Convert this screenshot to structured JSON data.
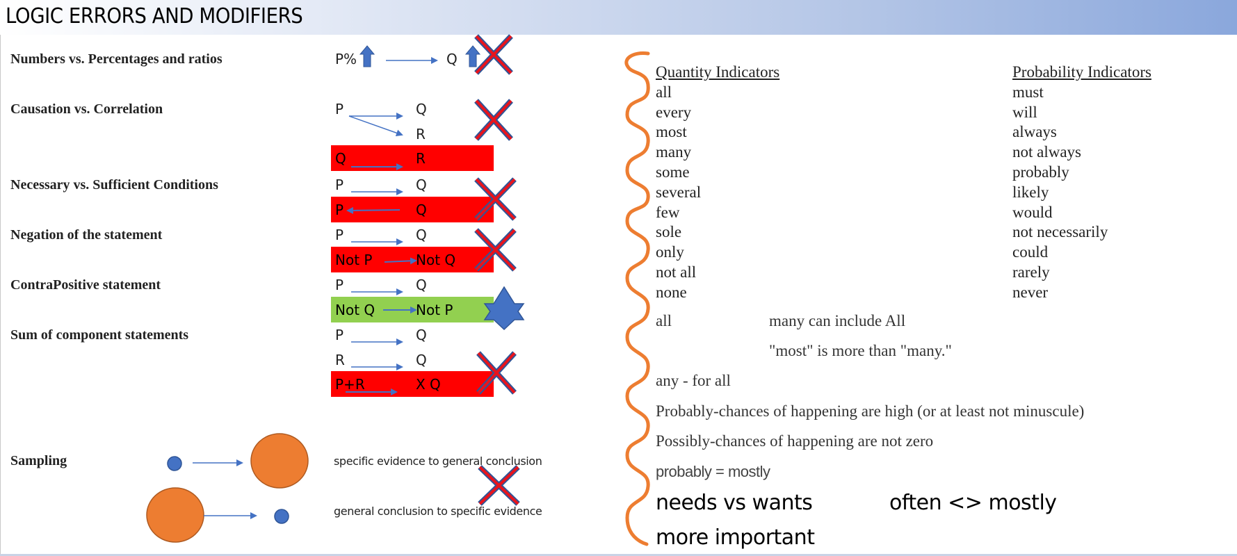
{
  "title": "LOGIC ERRORS AND MODIFIERS",
  "colors": {
    "error_bar": "#ff0000",
    "valid_bar": "#92d050",
    "arrow": "#4472c4",
    "cross": "#e8141c",
    "star": "#4472c4",
    "circle_large": "#ed7d31",
    "circle_small": "#4472c4",
    "brace": "#ed7d31"
  },
  "errors": [
    {
      "label": "Numbers vs. Percentages and ratios",
      "left": "P%",
      "right": "Q",
      "mark": "cross-icon"
    },
    {
      "label": "Causation vs. Correlation",
      "left": "P",
      "right_top": "Q",
      "right_bottom": "R",
      "bar_left": "Q",
      "bar_right": "R",
      "mark": "cross-icon"
    },
    {
      "label": "Necessary vs. Sufficient Conditions",
      "left": "P",
      "right": "Q",
      "bar_left": "P",
      "bar_right": "Q",
      "mark": "cross-icon"
    },
    {
      "label": "Negation of the statement",
      "left": "P",
      "right": "Q",
      "bar_left": "Not P",
      "bar_right": "Not Q",
      "mark": "cross-icon"
    },
    {
      "label": "ContraPositive statement",
      "left": "P",
      "right": "Q",
      "bar_left": "Not Q",
      "bar_right": "Not P",
      "mark": "star-icon"
    },
    {
      "label": "Sum of component statements",
      "row1_left": "P",
      "row1_right": "Q",
      "row2_left": "R",
      "row2_right": "Q",
      "bar_left": "P+R",
      "bar_right": "X Q",
      "mark": "cross-icon"
    }
  ],
  "sampling": {
    "label": "Sampling",
    "row1_text": "specific evidence to general conclusion",
    "row2_text": "general conclusion to specific evidence"
  },
  "quantity": {
    "heading": "Quantity Indicators",
    "items": [
      "all",
      "every",
      "most",
      "many",
      "some",
      "several",
      "few",
      "sole",
      "only",
      "not all",
      "none"
    ]
  },
  "probability": {
    "heading": "Probability Indicators",
    "items": [
      "must",
      "will",
      "always",
      "not always",
      "probably",
      "likely",
      "would",
      "not necessarily",
      "could",
      "rarely",
      "never"
    ]
  },
  "notes": {
    "all_label": "all",
    "many_note": "many can include All",
    "most_note": "\"most\" is more than \"many.\"",
    "any_note": "any - for all",
    "probably_note": "Probably-chances of happening are high (or at least not minuscule)",
    "possibly_note": "Possibly-chances of happening are not zero",
    "probably_mostly": "probably = mostly",
    "needs_wants": "needs vs wants",
    "often_mostly": "often <> mostly",
    "more_important": "more important"
  }
}
